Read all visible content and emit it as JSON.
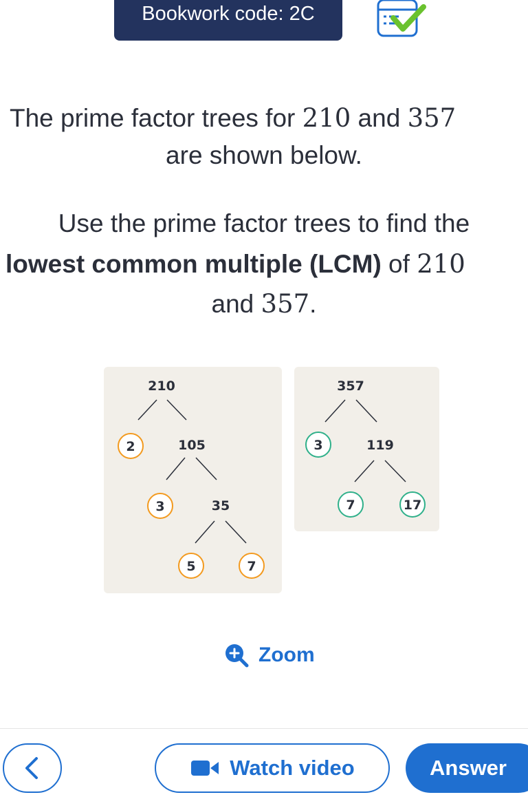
{
  "header": {
    "bookwork_label": "Bookwork code: 2C"
  },
  "question": {
    "line1_pre": "The prime factor trees for ",
    "line1_num1": "210",
    "line1_mid": " and ",
    "line1_num2": "357",
    "line2": "are shown below.",
    "line3": "Use the prime factor trees to find the",
    "line4_bold": "lowest common multiple (LCM)",
    "line4_mid": " of ",
    "line4_num": "210",
    "line5_pre": "and ",
    "line5_num": "357",
    "line5_post": "."
  },
  "tree_210": {
    "root": "210",
    "nodes": [
      "2",
      "105",
      "3",
      "35",
      "5",
      "7"
    ],
    "circled": [
      "2",
      "3",
      "5",
      "7"
    ],
    "circle_color": "#f39a1f"
  },
  "tree_357": {
    "root": "357",
    "nodes": [
      "3",
      "119",
      "7",
      "17"
    ],
    "circled": [
      "3",
      "7",
      "17"
    ],
    "circle_color": "#2fb08a"
  },
  "zoom_label": "Zoom",
  "footer": {
    "watch_label": "Watch video",
    "answer_label": "Answer"
  },
  "colors": {
    "accent": "#1f6fd0",
    "navy": "#23335e",
    "panel": "#f2efe9"
  },
  "icons": [
    "checklist-icon",
    "zoom-in-icon",
    "back-chevron-icon",
    "video-camera-icon"
  ]
}
